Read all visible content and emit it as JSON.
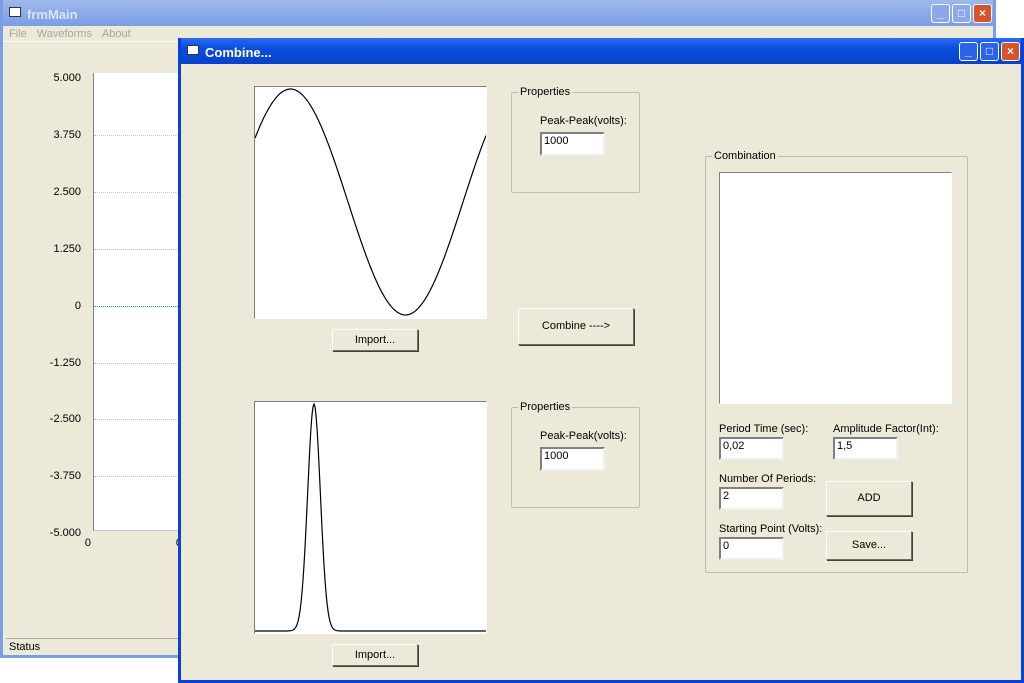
{
  "main_window": {
    "title": "frmMain",
    "menu": [
      "File",
      "Waveforms",
      "About"
    ],
    "chart": {
      "y_ticks": [
        "5.000",
        "3.750",
        "2.500",
        "1.250",
        "0",
        "-1.250",
        "-2.500",
        "-3.750",
        "-5.000"
      ],
      "x_ticks": [
        "0",
        "0"
      ]
    },
    "status": "Status"
  },
  "dialog": {
    "title": "Combine...",
    "import1_label": "Import...",
    "import2_label": "Import...",
    "properties1": {
      "legend": "Properties",
      "label": "Peak-Peak(volts):",
      "value": "1000"
    },
    "properties2": {
      "legend": "Properties",
      "label": "Peak-Peak(volts):",
      "value": "1000"
    },
    "combine_label": "Combine   ---->",
    "combination": {
      "legend": "Combination",
      "period_time_label": "Period Time (sec):",
      "period_time_value": "0,02",
      "amplitude_label": "Amplitude Factor(Int):",
      "amplitude_value": "1,5",
      "periods_label": "Number Of Periods:",
      "periods_value": "2",
      "start_label": "Starting Point (Volts):",
      "start_value": "0",
      "add_label": "ADD",
      "save_label": "Save..."
    },
    "waveform1": "sine",
    "waveform2": "pulse"
  }
}
